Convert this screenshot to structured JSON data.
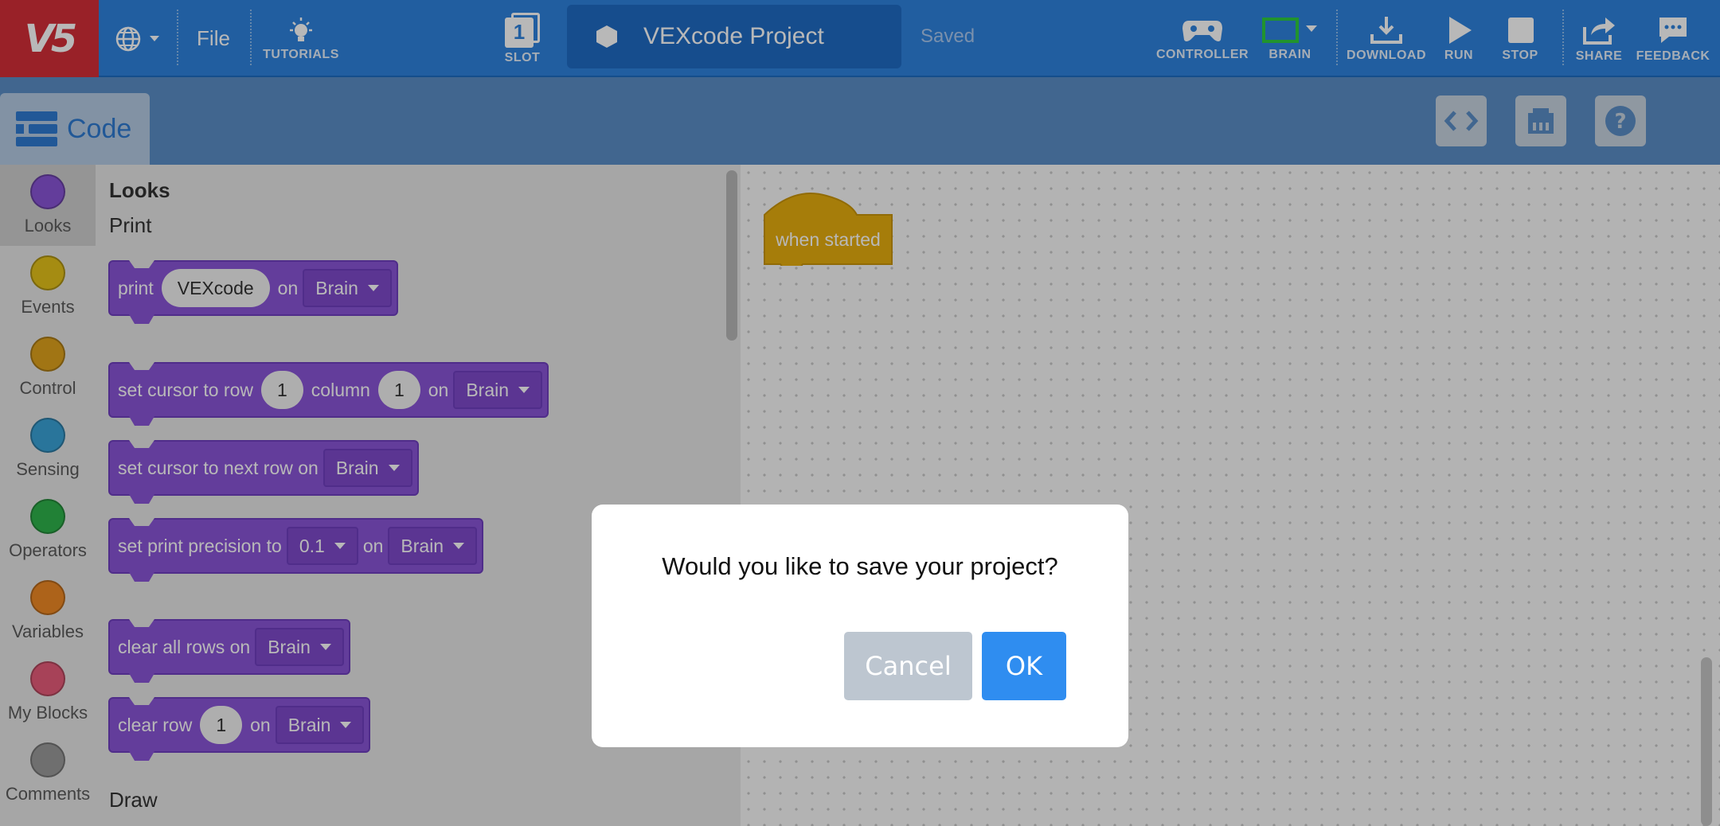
{
  "app": {
    "logo_text": "V5",
    "file_menu": "File",
    "tutorials": "TUTORIALS",
    "slot_number": "1",
    "slot_label": "SLOT",
    "project_name": "VEXcode Project",
    "save_status": "Saved",
    "controller": "CONTROLLER",
    "brain": "BRAIN",
    "download": "DOWNLOAD",
    "run": "RUN",
    "stop": "STOP",
    "share": "SHARE",
    "feedback": "FEEDBACK"
  },
  "tabs": {
    "code": "Code"
  },
  "categories": [
    {
      "name": "Looks",
      "color": "#8a55d7"
    },
    {
      "name": "Events",
      "color": "#e5c21a"
    },
    {
      "name": "Control",
      "color": "#e0a21c"
    },
    {
      "name": "Sensing",
      "color": "#3aa2d7"
    },
    {
      "name": "Operators",
      "color": "#2fb34b"
    },
    {
      "name": "Variables",
      "color": "#f08a24"
    },
    {
      "name": "My Blocks",
      "color": "#e85c7a"
    },
    {
      "name": "Comments",
      "color": "#9a9a9a"
    }
  ],
  "flyout": {
    "section": "Looks",
    "sub_print": "Print",
    "sub_draw": "Draw",
    "print_block": {
      "word": "print",
      "value": "VEXcode",
      "on": "on",
      "target": "Brain"
    },
    "cursor_block": {
      "text": "set cursor to row",
      "row": "1",
      "column_label": "column",
      "column": "1",
      "on": "on",
      "target": "Brain"
    },
    "next_row_block": {
      "text": "set cursor to next row on",
      "target": "Brain"
    },
    "precision_block": {
      "text": "set print precision to",
      "value": "0.1",
      "on": "on",
      "target": "Brain"
    },
    "clear_all_block": {
      "text": "clear all rows on",
      "target": "Brain"
    },
    "clear_row_block": {
      "text": "clear row",
      "row": "1",
      "on": "on",
      "target": "Brain"
    }
  },
  "workspace": {
    "hat_block": "when started"
  },
  "dialog": {
    "message": "Would you like to save your project?",
    "cancel": "Cancel",
    "ok": "OK"
  }
}
